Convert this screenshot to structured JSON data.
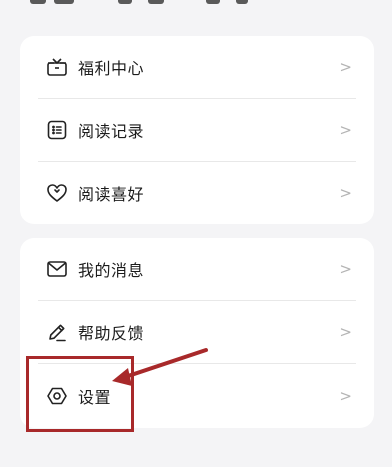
{
  "menu_group_1": {
    "items": [
      {
        "label": "福利中心",
        "icon": "gift-icon"
      },
      {
        "label": "阅读记录",
        "icon": "reading-history-icon"
      },
      {
        "label": "阅读喜好",
        "icon": "heart-icon"
      }
    ]
  },
  "menu_group_2": {
    "items": [
      {
        "label": "我的消息",
        "icon": "mail-icon"
      },
      {
        "label": "帮助反馈",
        "icon": "edit-pen-icon"
      },
      {
        "label": "设置",
        "icon": "settings-icon"
      }
    ]
  },
  "chevron": ">",
  "colors": {
    "background": "#f4f4f6",
    "card": "#ffffff",
    "annotation": "#a8292a"
  }
}
